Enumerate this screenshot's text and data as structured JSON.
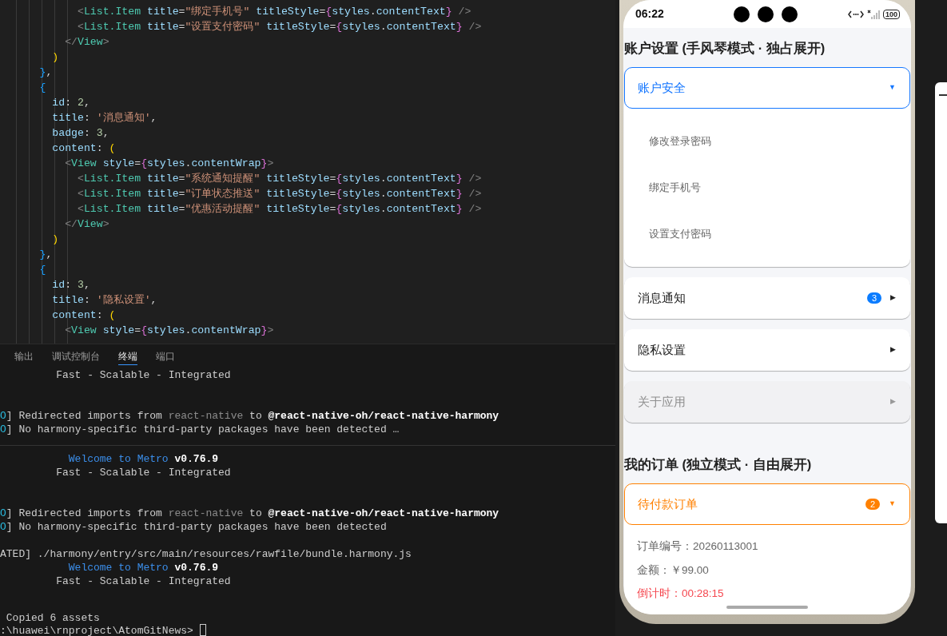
{
  "editor": {
    "lines": [
      [
        {
          "text": "            <",
          "kind": "p"
        },
        {
          "text": "List.Item",
          "kind": "tag"
        },
        {
          "text": " title",
          "kind": "attr"
        },
        {
          "text": "=",
          "kind": "op"
        },
        {
          "text": "\"绑定手机号\"",
          "kind": "str"
        },
        {
          "text": " titleStyle",
          "kind": "attr"
        },
        {
          "text": "=",
          "kind": "op"
        },
        {
          "text": "{",
          "kind": "b1"
        },
        {
          "text": "styles",
          "kind": "attr"
        },
        {
          "text": ".",
          "kind": "op"
        },
        {
          "text": "contentText",
          "kind": "attr"
        },
        {
          "text": "}",
          "kind": "b1"
        },
        {
          "text": " />",
          "kind": "p"
        }
      ],
      [
        {
          "text": "            <",
          "kind": "p"
        },
        {
          "text": "List.Item",
          "kind": "tag"
        },
        {
          "text": " title",
          "kind": "attr"
        },
        {
          "text": "=",
          "kind": "op"
        },
        {
          "text": "\"设置支付密码\"",
          "kind": "str"
        },
        {
          "text": " titleStyle",
          "kind": "attr"
        },
        {
          "text": "=",
          "kind": "op"
        },
        {
          "text": "{",
          "kind": "b1"
        },
        {
          "text": "styles",
          "kind": "attr"
        },
        {
          "text": ".",
          "kind": "op"
        },
        {
          "text": "contentText",
          "kind": "attr"
        },
        {
          "text": "}",
          "kind": "b1"
        },
        {
          "text": " />",
          "kind": "p"
        }
      ],
      [
        {
          "text": "          </",
          "kind": "p"
        },
        {
          "text": "View",
          "kind": "tag"
        },
        {
          "text": ">",
          "kind": "p"
        }
      ],
      [
        {
          "text": "        )",
          "kind": "b2"
        }
      ],
      [
        {
          "text": "      }",
          "kind": "b3"
        },
        {
          "text": ",",
          "kind": "op"
        }
      ],
      [
        {
          "text": "      {",
          "kind": "b3"
        }
      ],
      [
        {
          "text": "        id",
          "kind": "attr"
        },
        {
          "text": ": ",
          "kind": "op"
        },
        {
          "text": "2",
          "kind": "num"
        },
        {
          "text": ",",
          "kind": "op"
        }
      ],
      [
        {
          "text": "        title",
          "kind": "attr"
        },
        {
          "text": ": ",
          "kind": "op"
        },
        {
          "text": "'消息通知'",
          "kind": "str"
        },
        {
          "text": ",",
          "kind": "op"
        }
      ],
      [
        {
          "text": "        badge",
          "kind": "attr"
        },
        {
          "text": ": ",
          "kind": "op"
        },
        {
          "text": "3",
          "kind": "num"
        },
        {
          "text": ",",
          "kind": "op"
        }
      ],
      [
        {
          "text": "        content",
          "kind": "attr"
        },
        {
          "text": ": ",
          "kind": "op"
        },
        {
          "text": "(",
          "kind": "b2"
        }
      ],
      [
        {
          "text": "          <",
          "kind": "p"
        },
        {
          "text": "View",
          "kind": "tag"
        },
        {
          "text": " style",
          "kind": "attr"
        },
        {
          "text": "=",
          "kind": "op"
        },
        {
          "text": "{",
          "kind": "b1"
        },
        {
          "text": "styles",
          "kind": "attr"
        },
        {
          "text": ".",
          "kind": "op"
        },
        {
          "text": "contentWrap",
          "kind": "attr"
        },
        {
          "text": "}",
          "kind": "b1"
        },
        {
          "text": ">",
          "kind": "p"
        }
      ],
      [
        {
          "text": "            <",
          "kind": "p"
        },
        {
          "text": "List.Item",
          "kind": "tag"
        },
        {
          "text": " title",
          "kind": "attr"
        },
        {
          "text": "=",
          "kind": "op"
        },
        {
          "text": "\"系统通知提醒\"",
          "kind": "str"
        },
        {
          "text": " titleStyle",
          "kind": "attr"
        },
        {
          "text": "=",
          "kind": "op"
        },
        {
          "text": "{",
          "kind": "b1"
        },
        {
          "text": "styles",
          "kind": "attr"
        },
        {
          "text": ".",
          "kind": "op"
        },
        {
          "text": "contentText",
          "kind": "attr"
        },
        {
          "text": "}",
          "kind": "b1"
        },
        {
          "text": " />",
          "kind": "p"
        }
      ],
      [
        {
          "text": "            <",
          "kind": "p"
        },
        {
          "text": "List.Item",
          "kind": "tag"
        },
        {
          "text": " title",
          "kind": "attr"
        },
        {
          "text": "=",
          "kind": "op"
        },
        {
          "text": "\"订单状态推送\"",
          "kind": "str"
        },
        {
          "text": " titleStyle",
          "kind": "attr"
        },
        {
          "text": "=",
          "kind": "op"
        },
        {
          "text": "{",
          "kind": "b1"
        },
        {
          "text": "styles",
          "kind": "attr"
        },
        {
          "text": ".",
          "kind": "op"
        },
        {
          "text": "contentText",
          "kind": "attr"
        },
        {
          "text": "}",
          "kind": "b1"
        },
        {
          "text": " />",
          "kind": "p"
        }
      ],
      [
        {
          "text": "            <",
          "kind": "p"
        },
        {
          "text": "List.Item",
          "kind": "tag"
        },
        {
          "text": " title",
          "kind": "attr"
        },
        {
          "text": "=",
          "kind": "op"
        },
        {
          "text": "\"优惠活动提醒\"",
          "kind": "str"
        },
        {
          "text": " titleStyle",
          "kind": "attr"
        },
        {
          "text": "=",
          "kind": "op"
        },
        {
          "text": "{",
          "kind": "b1"
        },
        {
          "text": "styles",
          "kind": "attr"
        },
        {
          "text": ".",
          "kind": "op"
        },
        {
          "text": "contentText",
          "kind": "attr"
        },
        {
          "text": "}",
          "kind": "b1"
        },
        {
          "text": " />",
          "kind": "p"
        }
      ],
      [
        {
          "text": "          </",
          "kind": "p"
        },
        {
          "text": "View",
          "kind": "tag"
        },
        {
          "text": ">",
          "kind": "p"
        }
      ],
      [
        {
          "text": "        )",
          "kind": "b2"
        }
      ],
      [
        {
          "text": "      }",
          "kind": "b3"
        },
        {
          "text": ",",
          "kind": "op"
        }
      ],
      [
        {
          "text": "      {",
          "kind": "b3"
        }
      ],
      [
        {
          "text": "        id",
          "kind": "attr"
        },
        {
          "text": ": ",
          "kind": "op"
        },
        {
          "text": "3",
          "kind": "num"
        },
        {
          "text": ",",
          "kind": "op"
        }
      ],
      [
        {
          "text": "        title",
          "kind": "attr"
        },
        {
          "text": ": ",
          "kind": "op"
        },
        {
          "text": "'隐私设置'",
          "kind": "str"
        },
        {
          "text": ",",
          "kind": "op"
        }
      ],
      [
        {
          "text": "        content",
          "kind": "attr"
        },
        {
          "text": ": ",
          "kind": "op"
        },
        {
          "text": "(",
          "kind": "b2"
        }
      ],
      [
        {
          "text": "          <",
          "kind": "p"
        },
        {
          "text": "View",
          "kind": "tag"
        },
        {
          "text": " style",
          "kind": "attr"
        },
        {
          "text": "=",
          "kind": "op"
        },
        {
          "text": "{",
          "kind": "b1"
        },
        {
          "text": "styles",
          "kind": "attr"
        },
        {
          "text": ".",
          "kind": "op"
        },
        {
          "text": "contentWrap",
          "kind": "attr"
        },
        {
          "text": "}",
          "kind": "b1"
        },
        {
          "text": ">",
          "kind": "p"
        }
      ]
    ]
  },
  "panel": {
    "tabs": [
      {
        "label": "输出",
        "selected": false
      },
      {
        "label": "调试控制台",
        "selected": false
      },
      {
        "label": "终端",
        "selected": true
      },
      {
        "label": "端口",
        "selected": false
      }
    ],
    "blocks": [
      {
        "kind": "first",
        "lines": [
          [
            {
              "text": "         Fast - Scalable - Integrated",
              "kind": "txt"
            }
          ]
        ]
      },
      {
        "kind": "log",
        "lines": [
          [
            {
              "text": "O",
              "kind": "info"
            },
            {
              "text": "] Redirected imports from ",
              "kind": "txt"
            },
            {
              "text": "react-native",
              "kind": "dim"
            },
            {
              "text": " to ",
              "kind": "txt"
            },
            {
              "text": "@react-native-oh/react-native-harmony",
              "kind": "bold"
            }
          ],
          [
            {
              "text": "O",
              "kind": "info"
            },
            {
              "text": "] No harmony-specific third-party packages have been detected …",
              "kind": "txt"
            }
          ]
        ]
      },
      {
        "kind": "log",
        "divider_before": true,
        "lines": [
          [
            {
              "text": "           Welcome to Metro",
              "kind": "link"
            },
            {
              "text": " v0.76.9",
              "kind": "bold"
            }
          ],
          [
            {
              "text": "         Fast - Scalable - Integrated",
              "kind": "txt"
            }
          ]
        ]
      },
      {
        "kind": "log",
        "lines": [
          [
            {
              "text": "O",
              "kind": "info"
            },
            {
              "text": "] Redirected imports from ",
              "kind": "txt"
            },
            {
              "text": "react-native",
              "kind": "dim"
            },
            {
              "text": " to ",
              "kind": "txt"
            },
            {
              "text": "@react-native-oh/react-native-harmony",
              "kind": "bold"
            }
          ],
          [
            {
              "text": "O",
              "kind": "info"
            },
            {
              "text": "] No harmony-specific third-party packages have been detected",
              "kind": "txt"
            }
          ]
        ]
      },
      {
        "kind": "build",
        "lines": [
          [
            {
              "text": "ATED] ./harmony/entry/src/main/resources/rawfile/bundle.harmony.js",
              "kind": "txt"
            }
          ],
          [
            {
              "text": "           Welcome to Metro",
              "kind": "link"
            },
            {
              "text": " v0.76.9",
              "kind": "bold"
            }
          ],
          [
            {
              "text": "         Fast - Scalable - Integrated",
              "kind": "txt"
            }
          ]
        ]
      },
      {
        "kind": "prompt",
        "lines": [
          [
            {
              "text": " Copied 6 assets",
              "kind": "txt"
            }
          ],
          [
            {
              "text": ":\\huawei\\rnproject\\AtomGitNews>",
              "kind": "txt"
            }
          ]
        ]
      }
    ]
  },
  "phone": {
    "status_bar": {
      "time": "06:22",
      "battery": "100"
    },
    "sections": [
      {
        "title": "账户设置 (手风琴模式 · 独占展开)",
        "panels": [
          {
            "title": "账户安全",
            "color": "#1677ff",
            "indicator": "▼",
            "expanded": true,
            "disabled": false,
            "items": [
              {
                "kind": "list-item",
                "text": "修改登录密码"
              },
              {
                "kind": "list-item",
                "text": "绑定手机号"
              },
              {
                "kind": "list-item",
                "text": "设置支付密码"
              }
            ]
          },
          {
            "title": "消息通知",
            "color": "#0a7cff",
            "badge": "3",
            "indicator": "▶",
            "expanded": false,
            "disabled": false
          },
          {
            "title": "隐私设置",
            "indicator": "▶",
            "expanded": false,
            "disabled": false
          },
          {
            "title": "关于应用",
            "indicator": "▶",
            "expanded": false,
            "disabled": true
          }
        ]
      },
      {
        "title": "我的订单 (独立模式 · 自由展开)",
        "panels": [
          {
            "title": "待付款订单",
            "color": "#ff8000",
            "badge": "2",
            "indicator": "▼",
            "expanded": true,
            "disabled": false,
            "items": [
              {
                "kind": "info",
                "text": "订单编号：20260113001"
              },
              {
                "kind": "info",
                "text": "金额：￥99.00"
              },
              {
                "kind": "alert",
                "text": "倒计时：00:28:15"
              }
            ]
          }
        ]
      }
    ]
  }
}
